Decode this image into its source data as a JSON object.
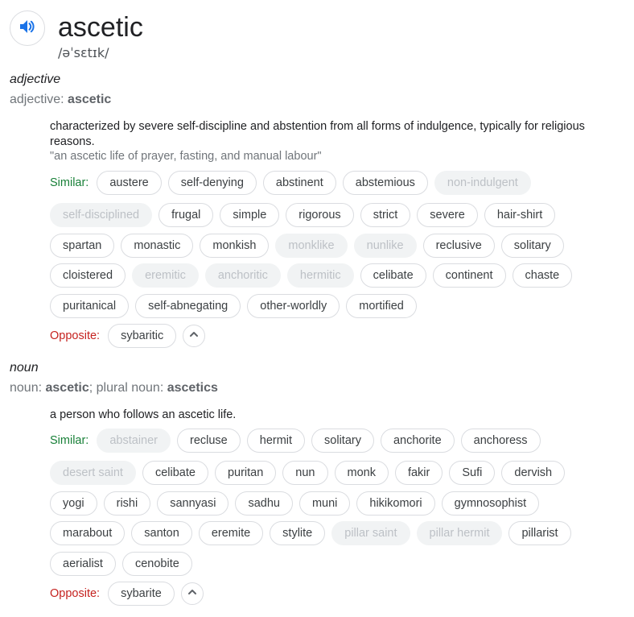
{
  "headword": "ascetic",
  "phonetic": "/əˈsɛtɪk/",
  "icons": {
    "speaker": "volume-speaker-icon",
    "collapse": "chevron-up-icon"
  },
  "colors": {
    "accent_blue": "#1a73e8",
    "similar_green": "#188038",
    "opposite_red": "#c5221f"
  },
  "adjective": {
    "pos": "adjective",
    "grammar_label": "adjective:",
    "grammar_word": "ascetic",
    "definition": "characterized by severe self-discipline and abstention from all forms of indulgence, typically for religious reasons.",
    "example": "\"an ascetic life of prayer, fasting, and manual labour\"",
    "similar_label": "Similar:",
    "opposite_label": "Opposite:",
    "rows": [
      [
        {
          "t": "austere"
        },
        {
          "t": "self-denying"
        },
        {
          "t": "abstinent"
        },
        {
          "t": "abstemious"
        },
        {
          "t": "non-indulgent",
          "dim": true
        }
      ],
      [
        {
          "t": "self-disciplined",
          "dim": true
        },
        {
          "t": "frugal"
        },
        {
          "t": "simple"
        },
        {
          "t": "rigorous"
        },
        {
          "t": "strict"
        },
        {
          "t": "severe"
        },
        {
          "t": "hair-shirt"
        }
      ],
      [
        {
          "t": "spartan"
        },
        {
          "t": "monastic"
        },
        {
          "t": "monkish"
        },
        {
          "t": "monklike",
          "dim": true
        },
        {
          "t": "nunlike",
          "dim": true
        },
        {
          "t": "reclusive"
        },
        {
          "t": "solitary"
        }
      ],
      [
        {
          "t": "cloistered"
        },
        {
          "t": "eremitic",
          "dim": true
        },
        {
          "t": "anchoritic",
          "dim": true
        },
        {
          "t": "hermitic",
          "dim": true
        },
        {
          "t": "celibate"
        },
        {
          "t": "continent"
        },
        {
          "t": "chaste"
        }
      ],
      [
        {
          "t": "puritanical"
        },
        {
          "t": "self-abnegating"
        },
        {
          "t": "other-worldly"
        },
        {
          "t": "mortified"
        }
      ]
    ],
    "opposite": [
      "sybaritic"
    ]
  },
  "noun": {
    "pos": "noun",
    "grammar_label": "noun:",
    "grammar_word": "ascetic",
    "plural_label": "; plural noun:",
    "plural_word": "ascetics",
    "definition": "a person who follows an ascetic life.",
    "similar_label": "Similar:",
    "opposite_label": "Opposite:",
    "rows": [
      [
        {
          "t": "abstainer",
          "dim": true
        },
        {
          "t": "recluse"
        },
        {
          "t": "hermit"
        },
        {
          "t": "solitary"
        },
        {
          "t": "anchorite"
        },
        {
          "t": "anchoress"
        }
      ],
      [
        {
          "t": "desert saint",
          "dim": true
        },
        {
          "t": "celibate"
        },
        {
          "t": "puritan"
        },
        {
          "t": "nun"
        },
        {
          "t": "monk"
        },
        {
          "t": "fakir"
        },
        {
          "t": "Sufi"
        },
        {
          "t": "dervish"
        }
      ],
      [
        {
          "t": "yogi"
        },
        {
          "t": "rishi"
        },
        {
          "t": "sannyasi"
        },
        {
          "t": "sadhu"
        },
        {
          "t": "muni"
        },
        {
          "t": "hikikomori"
        },
        {
          "t": "gymnosophist"
        }
      ],
      [
        {
          "t": "marabout"
        },
        {
          "t": "santon"
        },
        {
          "t": "eremite"
        },
        {
          "t": "stylite"
        },
        {
          "t": "pillar saint",
          "dim": true
        },
        {
          "t": "pillar hermit",
          "dim": true
        },
        {
          "t": "pillarist"
        }
      ],
      [
        {
          "t": "aerialist"
        },
        {
          "t": "cenobite"
        }
      ]
    ],
    "opposite": [
      "sybarite"
    ]
  }
}
